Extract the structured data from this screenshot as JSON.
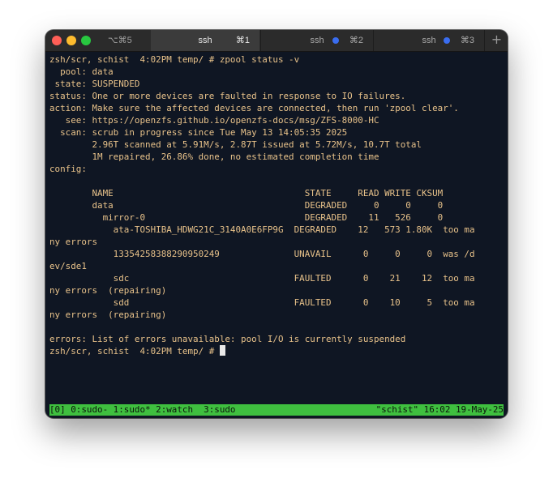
{
  "tabs": [
    {
      "label": "",
      "shortcut": "⌥⌘5"
    },
    {
      "label": "ssh",
      "shortcut": "⌘1",
      "active": true
    },
    {
      "label": "ssh",
      "shortcut": "⌘2",
      "badge_color": "#3a6df0"
    },
    {
      "label": "ssh",
      "shortcut": "⌘3",
      "badge_color": "#3a6df0"
    }
  ],
  "new_tab_label": "+",
  "terminal": {
    "lines": [
      "zsh/scr, schist  4:02PM temp/ # zpool status -v",
      "  pool: data",
      " state: SUSPENDED",
      "status: One or more devices are faulted in response to IO failures.",
      "action: Make sure the affected devices are connected, then run 'zpool clear'.",
      "   see: https://openzfs.github.io/openzfs-docs/msg/ZFS-8000-HC",
      "  scan: scrub in progress since Tue May 13 14:05:35 2025",
      "        2.96T scanned at 5.91M/s, 2.87T issued at 5.72M/s, 10.7T total",
      "        1M repaired, 26.86% done, no estimated completion time",
      "config:",
      "",
      "        NAME                                    STATE     READ WRITE CKSUM",
      "        data                                    DEGRADED     0     0     0",
      "          mirror-0                              DEGRADED    11   526     0",
      "            ata-TOSHIBA_HDWG21C_3140A0E6FP9G  DEGRADED    12   573 1.80K  too ma",
      "ny errors",
      "            13354258388290950249              UNAVAIL      0     0     0  was /d",
      "ev/sde1",
      "            sdc                               FAULTED      0    21    12  too ma",
      "ny errors  (repairing)",
      "            sdd                               FAULTED      0    10     5  too ma",
      "ny errors  (repairing)",
      "",
      "errors: List of errors unavailable: pool I/O is currently suspended"
    ],
    "prompt": "zsh/scr, schist  4:02PM temp/ # ",
    "text_color": "#e8c28a",
    "background": "#0f1623"
  },
  "statusbar": {
    "left": "[0] 0:sudo- 1:sudo* 2:watch  3:sudo",
    "right": "\"schist\" 16:02 19-May-25",
    "color": "#3fbf3f"
  }
}
